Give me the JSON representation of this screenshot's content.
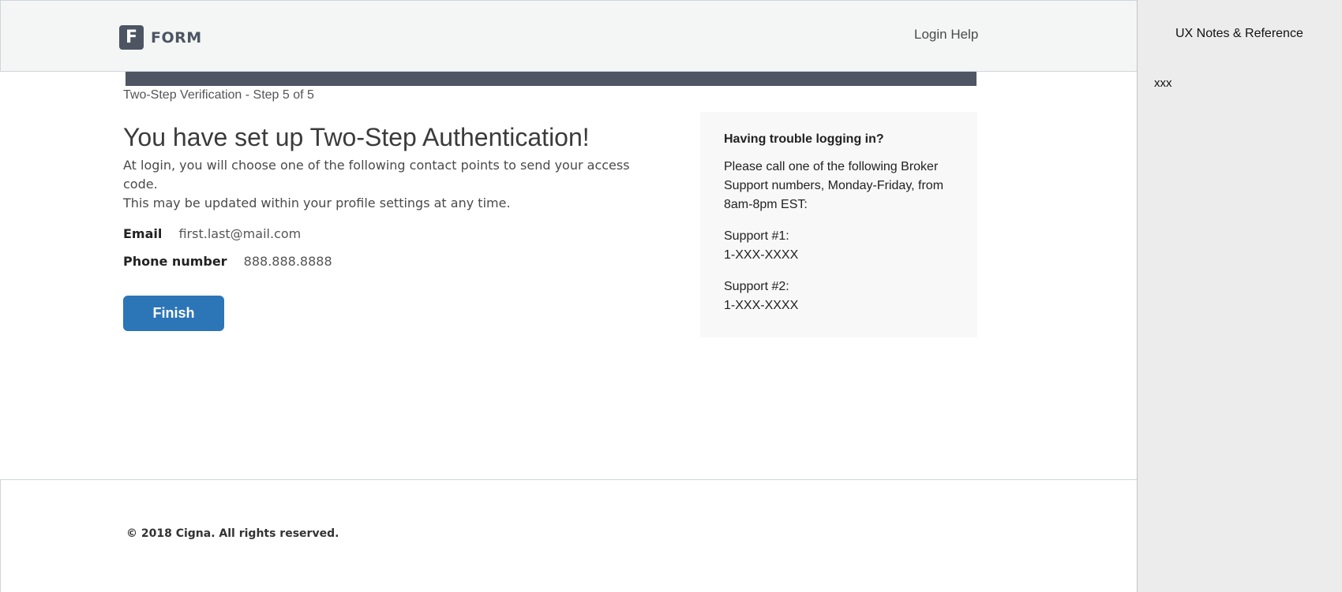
{
  "header": {
    "logo_letter": "F",
    "logo_text": "FORM",
    "login_help": "Login Help"
  },
  "progress": {
    "step_label": "Two-Step Verification - Step 5 of 5",
    "fraction": 1.0
  },
  "main": {
    "title": "You have set up Two-Step Authentication!",
    "desc_line1": "At login, you will choose one of the following contact points to send your access code.",
    "desc_line2": "This may be updated within your profile settings at any time.",
    "email_label": "Email",
    "email_value": "first.last@mail.com",
    "phone_label": "Phone number",
    "phone_value": "888.888.8888",
    "finish_label": "Finish"
  },
  "help": {
    "heading": "Having trouble logging in?",
    "text": "Please call one of the following Broker Support numbers, Monday-Friday, from 8am-8pm EST:",
    "support1_label": "Support #1:",
    "support1_value": "1-XXX-XXXX",
    "support2_label": "Support #2:",
    "support2_value": "1-XXX-XXXX"
  },
  "footer": {
    "copyright": "© 2018 Cigna. All rights reserved."
  },
  "notes": {
    "title": "UX Notes & Reference",
    "body": "xxx"
  },
  "colors": {
    "header_bg": "#f4f6f6",
    "progress": "#4f5562",
    "primary_button": "#2c75b7",
    "help_bg": "#f8f8f8",
    "notes_bg": "#ececec"
  }
}
